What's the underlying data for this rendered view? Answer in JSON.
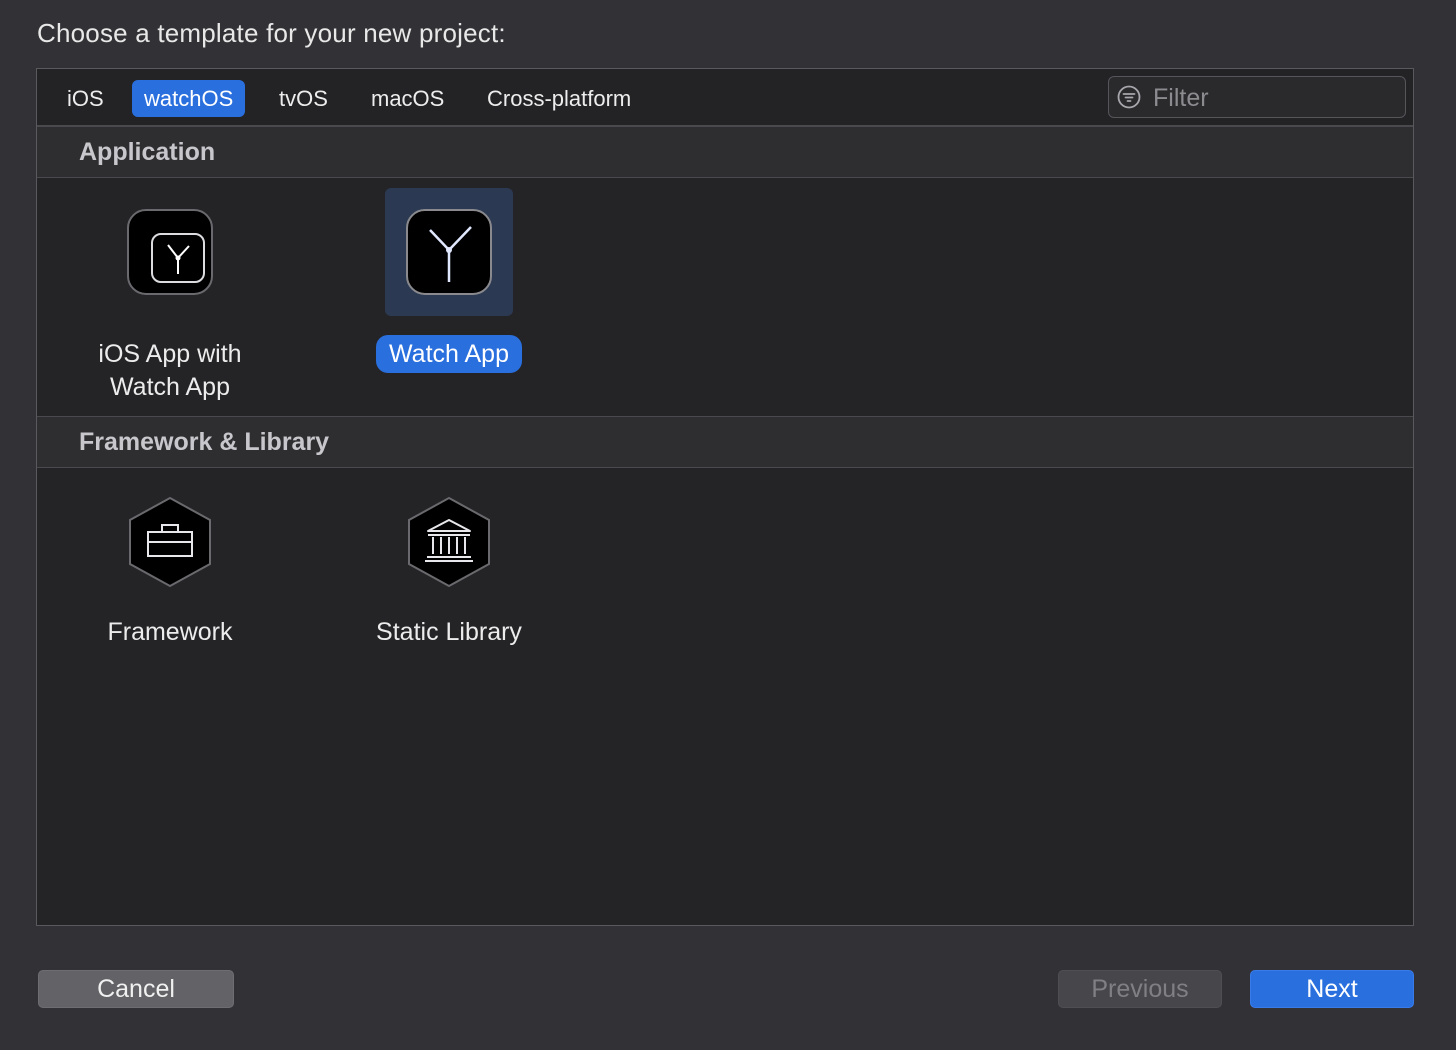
{
  "prompt": "Choose a template for your new project:",
  "tabs": [
    {
      "label": "iOS",
      "selected": false
    },
    {
      "label": "watchOS",
      "selected": true
    },
    {
      "label": "tvOS",
      "selected": false
    },
    {
      "label": "macOS",
      "selected": false
    },
    {
      "label": "Cross-platform",
      "selected": false
    }
  ],
  "filter": {
    "placeholder": "Filter",
    "value": "",
    "icon": "filter-icon"
  },
  "sections": [
    {
      "title": "Application",
      "items": [
        {
          "label_line1": "iOS App with",
          "label_line2": "Watch App",
          "icon": "watch-icon",
          "selected": false
        },
        {
          "label": "Watch App",
          "icon": "watch-icon",
          "selected": true
        }
      ]
    },
    {
      "title": "Framework & Library",
      "items": [
        {
          "label": "Framework",
          "icon": "toolbox-icon",
          "selected": false
        },
        {
          "label": "Static Library",
          "icon": "library-icon",
          "selected": false
        }
      ]
    }
  ],
  "buttons": {
    "cancel": "Cancel",
    "previous": "Previous",
    "next": "Next"
  },
  "colors": {
    "accent": "#2a6fde",
    "background": "#323236",
    "panel": "#242427"
  }
}
